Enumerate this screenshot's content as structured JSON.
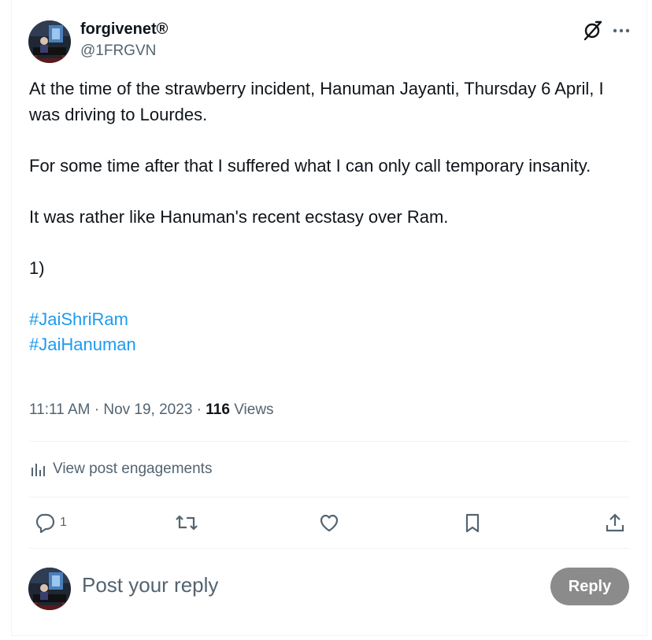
{
  "author": {
    "name": "forgivenet®",
    "handle": "@1FRGVN"
  },
  "header_icons": {
    "grok": "grok-slash-icon",
    "more": "more-dots-icon"
  },
  "post": {
    "lines": [
      "At the time of the strawberry incident, Hanuman Jayanti, Thursday 6 April, I was driving to Lourdes.",
      "For some time after that I suffered what I can only call temporary insanity.",
      "It was rather like Hanuman's recent ecstasy over Ram.",
      "1)"
    ],
    "hashtags": [
      "#JaiShriRam",
      "#JaiHanuman"
    ]
  },
  "meta": {
    "time": "11:11 AM",
    "separator": "·",
    "date": "Nov 19, 2023",
    "views_count": "116",
    "views_label": "Views"
  },
  "engagements": {
    "label": "View post engagements"
  },
  "actions": {
    "reply_count": "1",
    "icons": [
      "reply-icon",
      "repost-icon",
      "like-icon",
      "bookmark-icon",
      "share-icon"
    ]
  },
  "composer": {
    "placeholder": "Post your reply",
    "button_label": "Reply"
  },
  "colors": {
    "text": "#0f1419",
    "secondary": "#536471",
    "link": "#1d9bf0",
    "divider": "#eff3f4",
    "reply_button": "#8b8b8b"
  }
}
